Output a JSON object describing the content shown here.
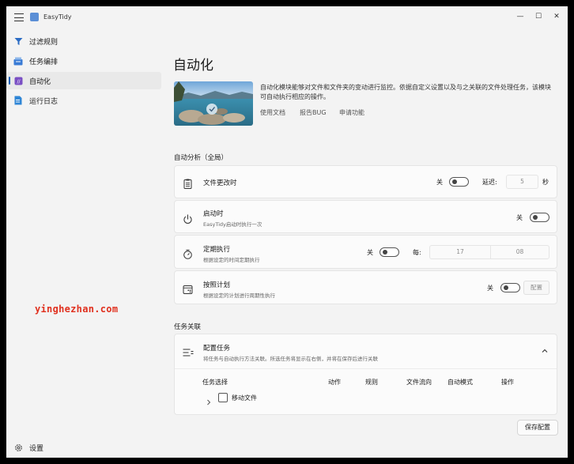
{
  "app": {
    "title": "EasyTidy"
  },
  "window_controls": {
    "minimize": "—",
    "maximize": "☐",
    "close": "✕"
  },
  "sidebar": {
    "items": [
      {
        "label": "过滤规则",
        "icon": "filter-icon"
      },
      {
        "label": "任务编排",
        "icon": "task-schedule-icon"
      },
      {
        "label": "自动化",
        "icon": "automation-icon",
        "selected": true
      },
      {
        "label": "运行日志",
        "icon": "log-icon"
      }
    ],
    "settings": {
      "label": "设置",
      "icon": "gear-icon"
    }
  },
  "page": {
    "title": "自动化",
    "description": "自动化模块能够对文件和文件夹的变动进行监控。依据自定义设置以及与之关联的文件处理任务，该模块可自动执行相应的操作。",
    "links": [
      "使用文档",
      "报告BUG",
      "申请功能"
    ]
  },
  "auto_analysis": {
    "title": "自动分析（全局）",
    "file_change": {
      "title": "文件更改时",
      "toggle": "关",
      "delay_label": "延迟:",
      "delay_value": "5",
      "delay_unit": "秒"
    },
    "on_startup": {
      "title": "启动时",
      "subtitle": "EasyTidy启动时执行一次",
      "toggle": "关"
    },
    "periodic": {
      "title": "定期执行",
      "subtitle": "根据设定的时间定期执行",
      "toggle": "关",
      "every_label": "每:",
      "hours": "17",
      "minutes": "08"
    },
    "schedule": {
      "title": "按照计划",
      "subtitle": "根据设定的计划进行周期性执行",
      "toggle": "关",
      "config_label": "配置"
    }
  },
  "task_link": {
    "title": "任务关联",
    "config": {
      "title": "配置任务",
      "subtitle": "将任务与自动执行方法关联。所选任务将显示在右侧，并将在保存后进行关联"
    },
    "columns": [
      "任务选择",
      "动作",
      "规则",
      "文件流向",
      "自动模式",
      "操作"
    ],
    "rows": [
      {
        "label": "移动文件"
      }
    ]
  },
  "save_button": "保存配置",
  "watermark": "yinghezhan.com",
  "colors": {
    "accent": "#005fb8",
    "watermark": "#e0301e"
  }
}
